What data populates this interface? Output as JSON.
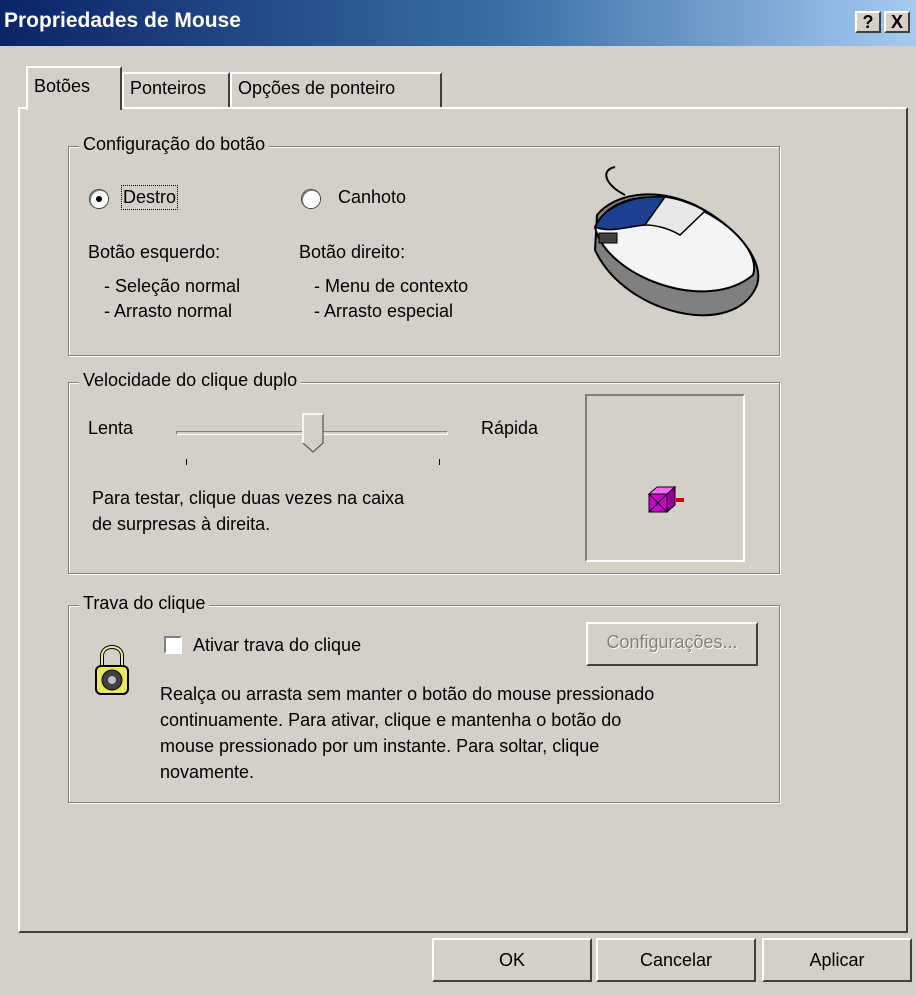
{
  "window": {
    "title": "Propriedades de Mouse",
    "help_button": "?",
    "close_button": "X"
  },
  "tabs": [
    {
      "label": "Botões",
      "active": true
    },
    {
      "label": "Ponteiros",
      "active": false
    },
    {
      "label": "Opções de ponteiro",
      "active": false
    }
  ],
  "button_config": {
    "legend": "Configuração do botão",
    "right_handed": {
      "label": "Destro",
      "selected": true
    },
    "left_handed": {
      "label": "Canhoto",
      "selected": false
    },
    "left_button_title": "Botão esquerdo:",
    "left_button_items": [
      "- Seleção normal",
      "- Arrasto normal"
    ],
    "right_button_title": "Botão direito:",
    "right_button_items": [
      "- Menu de contexto",
      "- Arrasto especial"
    ]
  },
  "double_click": {
    "legend": "Velocidade do clique duplo",
    "slow_label": "Lenta",
    "fast_label": "Rápida",
    "slider_value": 0.5,
    "instructions_line1": "Para testar, clique duas vezes na caixa",
    "instructions_line2": "de surpresas à direita."
  },
  "click_lock": {
    "legend": "Trava do clique",
    "checkbox_label": "Ativar trava do clique",
    "checked": false,
    "settings_button": "Configurações...",
    "description": [
      "Realça ou arrasta sem manter o botão do mouse pressionado",
      "continuamente. Para ativar, clique e mantenha o botão do",
      "mouse pressionado por um instante. Para soltar, clique",
      "novamente."
    ]
  },
  "footer": {
    "ok": "OK",
    "cancel": "Cancelar",
    "apply": "Aplicar"
  },
  "icons": [
    "mouse-icon",
    "jack-in-box-icon",
    "padlock-icon"
  ],
  "colors": {
    "titlebar_start": "#0a246a",
    "titlebar_end": "#a6caf0",
    "face": "#d4d0c8"
  }
}
